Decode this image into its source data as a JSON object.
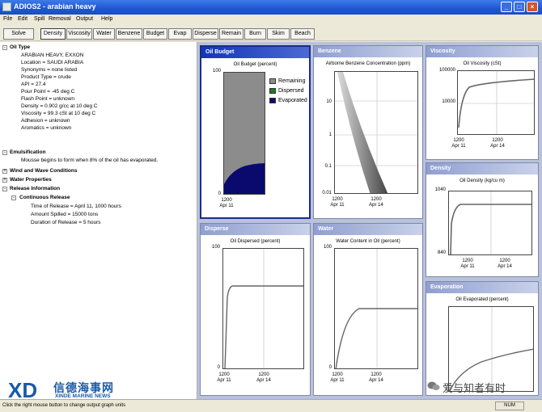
{
  "window": {
    "title": "ADIOS2 - arabian heavy"
  },
  "menu": [
    "File",
    "Edit",
    "Spill",
    "Removal",
    "Output",
    "Help"
  ],
  "toolbar": {
    "solve_label": "Solve",
    "tabs": [
      "Density",
      "Viscosity",
      "Water",
      "Benzene",
      "Budget",
      "Evap",
      "Disperse",
      "Remain",
      "Burn",
      "Skim",
      "Beach"
    ],
    "active_tab": "Density"
  },
  "tree": {
    "oil_type": {
      "label": "Oil Type",
      "items": [
        "ARABIAN HEAVY, EXXON",
        "Location = SAUDI ARABIA",
        "Synonyms = none listed",
        "Product Type = crude",
        "API = 27.4",
        "Pour Point = -45 deg C",
        "Flash Point = unknown",
        "Density = 0.902 g/cc at 10 deg C",
        "Viscosity = 99.3 cSt at 10 deg C",
        "Adhesion = unknown",
        "Aromatics = unknown"
      ]
    },
    "emulsification": {
      "label": "Emulsification",
      "items": [
        "Mousse begins to form when 8% of the oil has evaporated."
      ]
    },
    "wind": {
      "label": "Wind and Wave Conditions"
    },
    "water": {
      "label": "Water Properties"
    },
    "release": {
      "label": "Release Information",
      "sub_label": "Continuous Release",
      "items": [
        "Time of Release = April 11, 1000 hours",
        "Amount Spilled = 15000 tons",
        "Duration of Release = 5 hours"
      ]
    }
  },
  "panels": {
    "oil_budget": {
      "header": "Oil Budget",
      "title": "Oil Budget (percent)",
      "yticks": [
        "100",
        "0"
      ],
      "xticks": [
        "1200\nApr 11"
      ],
      "legend": [
        {
          "label": "Remaining",
          "color": "#8c8c8c"
        },
        {
          "label": "Dispersed",
          "color": "#1f7a1f"
        },
        {
          "label": "Evaporated",
          "color": "#0a0a6e"
        }
      ]
    },
    "benzene": {
      "header": "Benzene",
      "title": "Airborne Benzene Concentration (ppm)",
      "yticks": [
        "10",
        "1",
        "0.1",
        "0.01"
      ],
      "xticks": [
        "1200\nApr 11",
        "1200\nApr 14"
      ]
    },
    "viscosity": {
      "header": "Viscosity",
      "title": "Oil Viscosity (cSt)",
      "yticks": [
        "100000",
        "10000"
      ],
      "xticks": [
        "1200\nApr 11",
        "1200\nApr 14"
      ]
    },
    "density": {
      "header": "Density",
      "title": "Oil Density (kg/cu m)",
      "yticks": [
        "1040",
        "840"
      ],
      "xticks": [
        "1200\nApr 11",
        "1200\nApr 14"
      ]
    },
    "disperse": {
      "header": "Disperse",
      "title": "Oil Dispersed (percent)",
      "yticks": [
        "100",
        "0"
      ],
      "xticks": [
        "1200\nApr 11",
        "1200\nApr 14"
      ]
    },
    "water": {
      "header": "Water",
      "title": "Water Content in Oil (percent)",
      "yticks": [
        "100",
        "0"
      ],
      "xticks": [
        "1200\nApr 11",
        "1200\nApr 14"
      ]
    },
    "evaporation": {
      "header": "Evaporation",
      "title": "Oil Evaporated (percent)"
    }
  },
  "status": {
    "hint": "Click the right mouse button to change output graph units",
    "num": "NUM"
  },
  "watermark": {
    "brand_cn": "信德海事网",
    "brand_en": "XINDE MARINE NEWS",
    "wechat": "爱与知者有时"
  }
}
